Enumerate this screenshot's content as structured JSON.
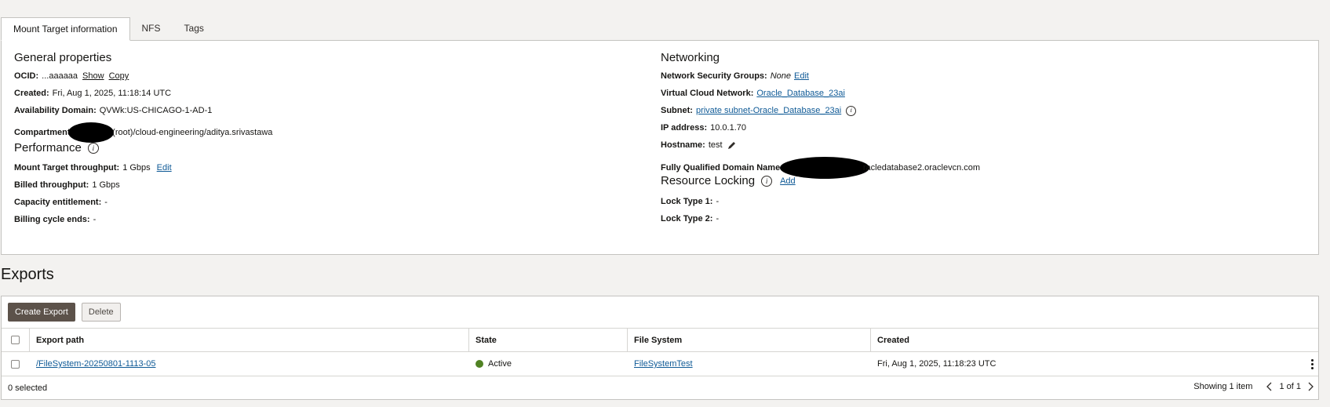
{
  "tabs": [
    "Mount Target information",
    "NFS",
    "Tags"
  ],
  "general": {
    "title": "General properties",
    "ocid_label": "OCID:",
    "ocid_value": "...aaaaaa",
    "show": "Show",
    "copy": "Copy",
    "created_label": "Created:",
    "created_value": "Fri, Aug 1, 2025, 11:18:14 UTC",
    "ad_label": "Availability Domain:",
    "ad_value": "QVWk:US-CHICAGO-1-AD-1",
    "compartment_label": "Compartment:",
    "compartment_value": "(root)/cloud-engineering/aditya.srivastawa"
  },
  "performance": {
    "title": "Performance",
    "throughput_label": "Mount Target throughput:",
    "throughput_value": "1 Gbps",
    "edit": "Edit",
    "billed_label": "Billed throughput:",
    "billed_value": "1 Gbps",
    "capacity_label": "Capacity entitlement:",
    "capacity_value": "-",
    "billing_label": "Billing cycle ends:",
    "billing_value": "-"
  },
  "networking": {
    "title": "Networking",
    "nsg_label": "Network Security Groups:",
    "nsg_value": "None",
    "nsg_edit": "Edit",
    "vcn_label": "Virtual Cloud Network:",
    "vcn_value": "Oracle_Database_23ai",
    "subnet_label": "Subnet:",
    "subnet_value": "private subnet-Oracle_Database_23ai",
    "ip_label": "IP address:",
    "ip_value": "10.0.1.70",
    "hostname_label": "Hostname:",
    "hostname_value": "test",
    "fqdn_label": "Fully Qualified Domain Name:",
    "fqdn_value": "racledatabase2.oraclevcn.com"
  },
  "locking": {
    "title": "Resource Locking",
    "add": "Add",
    "lock1_label": "Lock Type 1:",
    "lock1_value": "-",
    "lock2_label": "Lock Type 2:",
    "lock2_value": "-"
  },
  "exports": {
    "title": "Exports",
    "create_button": "Create Export",
    "delete_button": "Delete",
    "columns": [
      "Export path",
      "State",
      "File System",
      "Created"
    ],
    "rows": [
      {
        "path": "/FileSystem-20250801-1113-05",
        "state": "Active",
        "file_system": "FileSystemTest",
        "created": "Fri, Aug 1, 2025, 11:18:23 UTC"
      }
    ],
    "selected_text": "0 selected",
    "showing_text": "Showing 1 item",
    "page_text": "1 of 1"
  },
  "colors": {
    "accent_link": "#0f5a96",
    "status_active": "#508223",
    "primary_button": "#5c524a"
  }
}
